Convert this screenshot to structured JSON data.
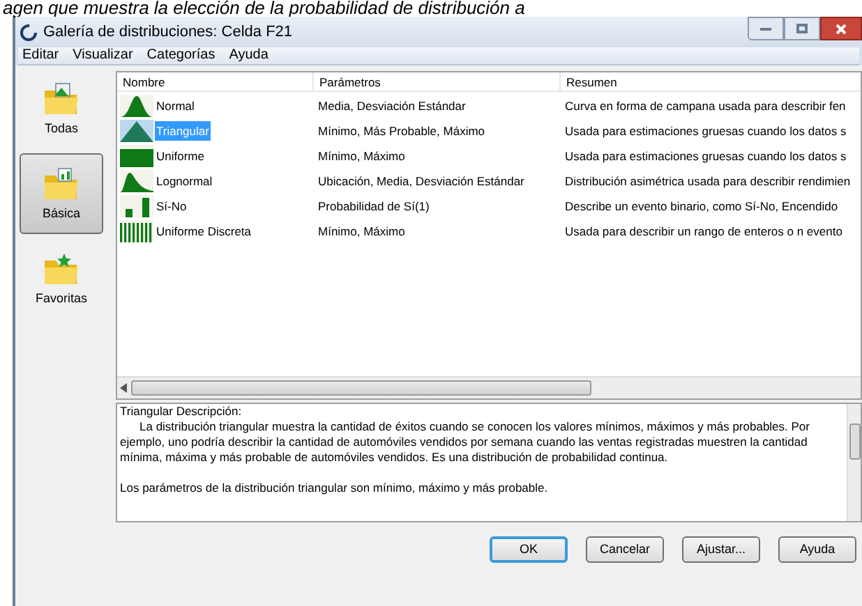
{
  "caption": "agen que muestra la elección de la probabilidad de distribución a",
  "window": {
    "title": "Galería de distribuciones: Celda F21"
  },
  "menu": [
    "Editar",
    "Visualizar",
    "Categorías",
    "Ayuda"
  ],
  "categories": [
    {
      "label": "Todas",
      "kind": "all",
      "selected": false
    },
    {
      "label": "Básica",
      "kind": "basic",
      "selected": true
    },
    {
      "label": "Favoritas",
      "kind": "favorites",
      "selected": false
    }
  ],
  "table": {
    "columns": [
      "Nombre",
      "Parámetros",
      "Resumen"
    ],
    "rows": [
      {
        "kind": "bell",
        "name": "Normal",
        "params": "Media, Desviación Estándar",
        "summary": "Curva en forma de campana usada para describir fen",
        "selected": false
      },
      {
        "kind": "triangle",
        "name": "Triangular",
        "params": "Mínimo, Más Probable, Máximo",
        "summary": "Usada para estimaciones gruesas cuando los datos s",
        "selected": true
      },
      {
        "kind": "uniform",
        "name": "Uniforme",
        "params": "Mínimo, Máximo",
        "summary": "Usada para estimaciones gruesas cuando los datos s",
        "selected": false
      },
      {
        "kind": "lognormal",
        "name": "Lognormal",
        "params": "Ubicación, Media, Desviación Estándar",
        "summary": "Distribución asimétrica usada para describir rendimien",
        "selected": false
      },
      {
        "kind": "yesno",
        "name": "Sí-No",
        "params": "Probabilidad de Sí(1)",
        "summary": "Describe un evento binario, como Sí-No, Encendido",
        "selected": false
      },
      {
        "kind": "discrete",
        "name": "Uniforme Discreta",
        "params": "Mínimo, Máximo",
        "summary": "Usada para describir un rango de enteros o n evento",
        "selected": false
      }
    ]
  },
  "description": {
    "title": "Triangular Descripción:",
    "paragraphs": [
      "La distribución triangular muestra la cantidad de éxitos cuando se conocen los valores mínimos, máximos y más probables. Por ejemplo, uno podría describir la cantidad de automóviles vendidos por semana cuando las ventas registradas muestren la cantidad mínima, máxima y más probable de automóviles vendidos. Es una distribución de probabilidad continua.",
      "Los parámetros de la distribución triangular son mínimo, máximo y más probable."
    ]
  },
  "buttons": [
    {
      "label": "OK",
      "default": true
    },
    {
      "label": "Cancelar",
      "default": false
    },
    {
      "label": "Ajustar...",
      "default": false
    },
    {
      "label": "Ayuda",
      "default": false
    }
  ]
}
